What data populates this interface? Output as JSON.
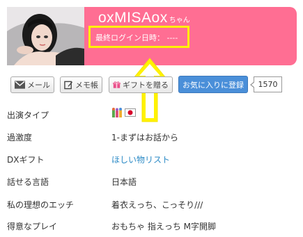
{
  "profile": {
    "name": "oxMISAox",
    "honorific": "ちゃん",
    "last_login": "最終ログイン日時： ----"
  },
  "actions": {
    "mail_label": "メール",
    "memo_label": "メモ帳",
    "gift_label": "ギフトを贈る",
    "favorite_label": "お気に入りに登録",
    "favorite_count": "1570"
  },
  "details": [
    {
      "label": "出演タイプ",
      "value": ""
    },
    {
      "label": "過激度",
      "value": "1-まずはお話から"
    },
    {
      "label": "DXギフト",
      "value": "ほしい物リスト"
    },
    {
      "label": "話せる言語",
      "value": "日本語"
    },
    {
      "label": "私の理想のエッチ",
      "value": "着衣えっち、こっそり///"
    },
    {
      "label": "得意なプレイ",
      "value": "おもちゃ 指えっち M字開脚"
    }
  ],
  "colors": {
    "header": "#ff6e93",
    "highlight": "#fff200",
    "favorite": "#4a8fd9",
    "link": "#2b8ac6"
  },
  "icons": [
    "envelope-icon",
    "pencil-icon",
    "gift-icon",
    "people-icon",
    "japan-flag-icon",
    "arrow-up-icon"
  ]
}
